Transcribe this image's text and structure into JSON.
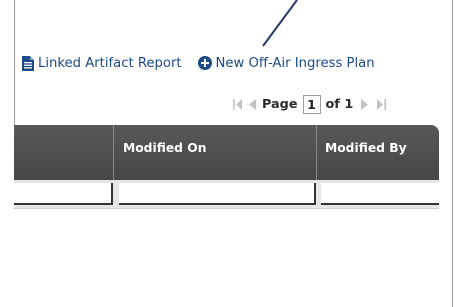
{
  "toolbar": {
    "linked_report_label": "Linked Artifact Report",
    "new_plan_label": "New Off-Air Ingress Plan"
  },
  "pager": {
    "page_label": "Page",
    "current_page": "1",
    "of_label": "of 1"
  },
  "grid": {
    "columns": [
      "Modified On",
      "Modified By"
    ]
  },
  "colors": {
    "link": "#1e4b86",
    "header_bg": "#4f4f4f",
    "filter_bg": "#e6e6e6"
  }
}
